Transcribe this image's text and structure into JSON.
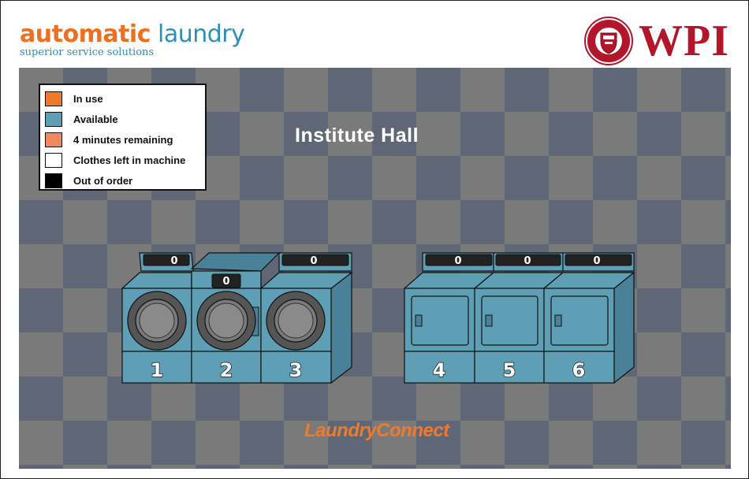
{
  "header": {
    "brand_part1": "auto",
    "brand_part2": "matic",
    "brand_part3": " laundry",
    "brand_tagline": "superior service solutions",
    "wpi_text": "WPI",
    "seal_icon": "wpi-seal-icon"
  },
  "hall_name": "Institute Hall",
  "footer_brand": "LaundryConnect",
  "legend": [
    {
      "label": "In use",
      "color": "#f07a2c"
    },
    {
      "label": "Available",
      "color": "#5f9fb6"
    },
    {
      "label": "4 minutes remaining",
      "color": "#f08a5d"
    },
    {
      "label": "Clothes left in machine",
      "color": "#ffffff"
    },
    {
      "label": "Out of order",
      "color": "#000000"
    }
  ],
  "machines": [
    {
      "number": "1",
      "type": "washer",
      "status": "Available",
      "counter": "0"
    },
    {
      "number": "2",
      "type": "washer",
      "status": "Available",
      "counter": "0"
    },
    {
      "number": "3",
      "type": "washer",
      "status": "Available",
      "counter": "0"
    },
    {
      "number": "4",
      "type": "dryer",
      "status": "Available",
      "counter": "0"
    },
    {
      "number": "5",
      "type": "dryer",
      "status": "Available",
      "counter": "0"
    },
    {
      "number": "6",
      "type": "dryer",
      "status": "Available",
      "counter": "0"
    }
  ],
  "colors": {
    "available": "#5f9fb6",
    "available_dark": "#4a8199",
    "accent_orange": "#f07a2c",
    "wpi_red": "#b3152a"
  }
}
